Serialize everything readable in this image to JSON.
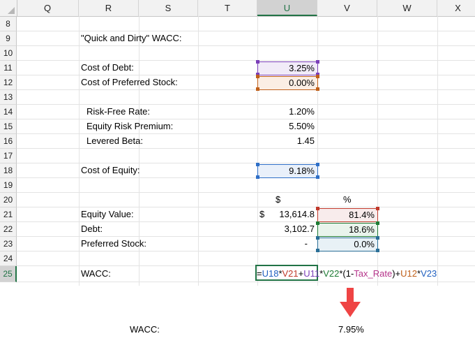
{
  "columns": [
    "Q",
    "R",
    "S",
    "T",
    "U",
    "V",
    "W",
    "X"
  ],
  "selected_column": "U",
  "rows": [
    "8",
    "9",
    "10",
    "11",
    "12",
    "13",
    "14",
    "15",
    "16",
    "17",
    "18",
    "19",
    "20",
    "21",
    "22",
    "23",
    "24",
    "25"
  ],
  "selected_row": "25",
  "sheet": {
    "title": "\"Quick and Dirty\" WACC:",
    "cost_of_debt": {
      "label": "Cost of Debt:",
      "value": "3.25%"
    },
    "cost_of_preferred": {
      "label": "Cost of Preferred Stock:",
      "value": "0.00%"
    },
    "risk_free": {
      "label": "Risk-Free Rate:",
      "value": "1.20%"
    },
    "equity_risk_premium": {
      "label": "Equity Risk Premium:",
      "value": "5.50%"
    },
    "levered_beta": {
      "label": "Levered Beta:",
      "value": "1.45"
    },
    "cost_of_equity": {
      "label": "Cost of Equity:",
      "value": "9.18%"
    },
    "header_dollar": "$",
    "header_percent": "%",
    "equity_value": {
      "label": "Equity Value:",
      "currency": "$",
      "amount": "13,614.8",
      "pct": "81.4%"
    },
    "debt": {
      "label": "Debt:",
      "amount": "3,102.7",
      "pct": "18.6%"
    },
    "preferred_stock": {
      "label": "Preferred Stock:",
      "amount": "-",
      "pct": "0.0%"
    },
    "wacc_label": "WACC:",
    "formula": {
      "eq": "=",
      "p1": "U18",
      "op1": "*",
      "p2": "V21",
      "op2": "+",
      "p3": "U11",
      "op3": "*",
      "p4": "V22",
      "op4": "*(1-",
      "p5": "Tax_Rate",
      "op5": ")+",
      "p6": "U12",
      "op6": "*",
      "p7": "V23"
    }
  },
  "result": {
    "label": "WACC:",
    "value": "7.95%"
  },
  "colors": {
    "purple": "#7b3fb8",
    "orange": "#c0601a",
    "blue": "#2f6fc7",
    "red": "#c0392b",
    "green": "#1e7b34",
    "teal": "#2a6f97",
    "arrow": "#ef4444",
    "excel_green": "#217346"
  }
}
